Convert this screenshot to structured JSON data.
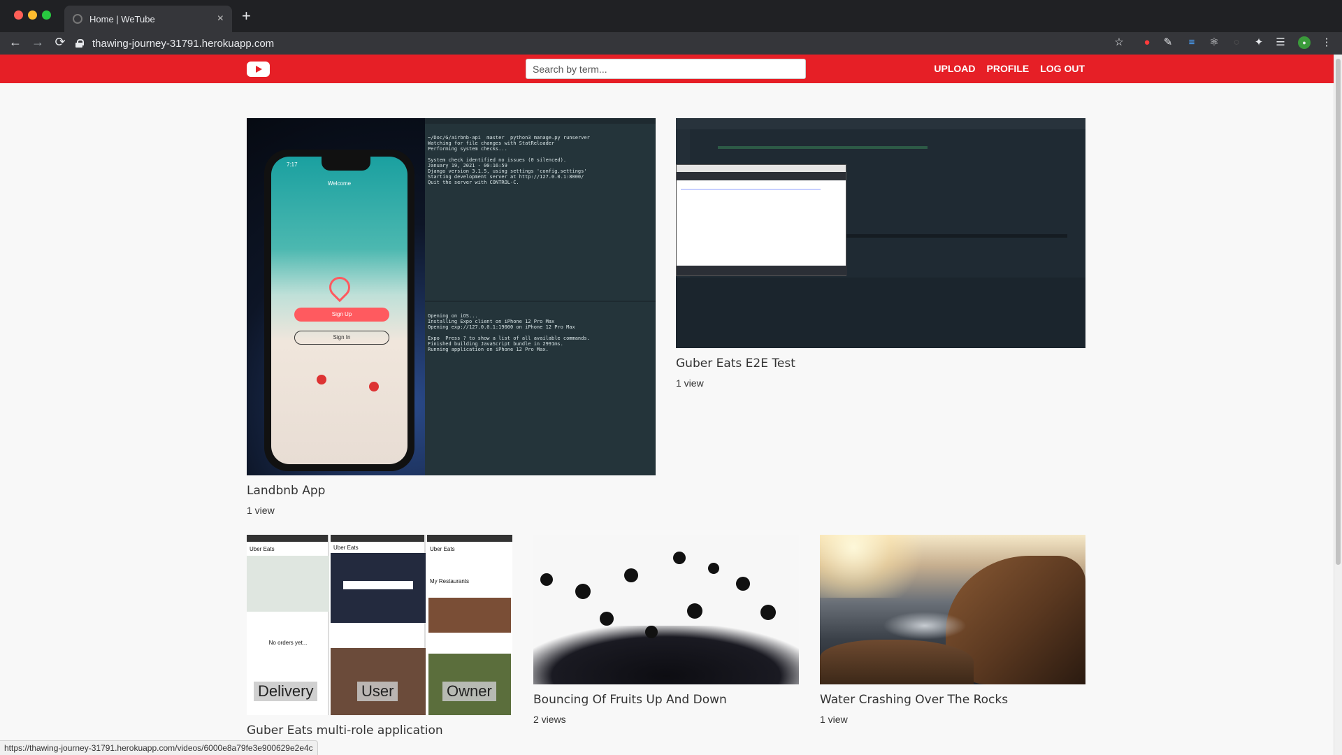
{
  "browser": {
    "tab_title": "Home | WeTube",
    "tab_close": "×",
    "new_tab": "+",
    "url": "thawing-journey-31791.herokuapp.com",
    "status_url": "https://thawing-journey-31791.herokuapp.com/videos/6000e8a79fe3e900629e2e4c",
    "traffic_colors": [
      "#ff5f57",
      "#febc2e",
      "#28c840"
    ]
  },
  "header": {
    "brand_color": "#e61f26",
    "search_placeholder": "Search by term...",
    "nav": [
      "UPLOAD",
      "PROFILE",
      "LOG OUT"
    ]
  },
  "videos": [
    {
      "title": "Landbnb App",
      "views": "1 view",
      "thumb": {
        "phone_time": "7:17",
        "welcome": "Welcome",
        "sign_up": "Sign Up",
        "sign_in": "Sign In",
        "term_top": "~/Doc/G/airbnb-api  master  python3 manage.py runserver\nWatching for file changes with StatReloader\nPerforming system checks...\n\nSystem check identified no issues (0 silenced).\nJanuary 19, 2021 - 00:16:59\nDjango version 3.1.5, using settings 'config.settings'\nStarting development server at http://127.0.0.1:8000/\nQuit the server with CONTROL-C.",
        "term_bottom": "Opening on iOS...\nInstalling Expo client on iPhone 12 Pro Max\nOpening exp://127.0.0.1:19000 on iPhone 12 Pro Max\n\nExpo  Press ? to show a list of all available commands.\nFinished building JavaScript bundle in 2991ms.\nRunning application on iPhone 12 Pro Max."
      }
    },
    {
      "title": "Guber Eats E2E Test",
      "views": "1 view"
    },
    {
      "title": "Guber Eats multi-role application",
      "views": "",
      "thumb": {
        "labels": [
          "Delivery",
          "User",
          "Owner"
        ],
        "brand": "Uber Eats",
        "no_orders": "No orders yet...",
        "my_restaurants": "My Restaurants"
      }
    },
    {
      "title": "Bouncing Of Fruits Up And Down",
      "views": "2 views"
    },
    {
      "title": "Water Crashing Over The Rocks",
      "views": "1 view"
    }
  ]
}
